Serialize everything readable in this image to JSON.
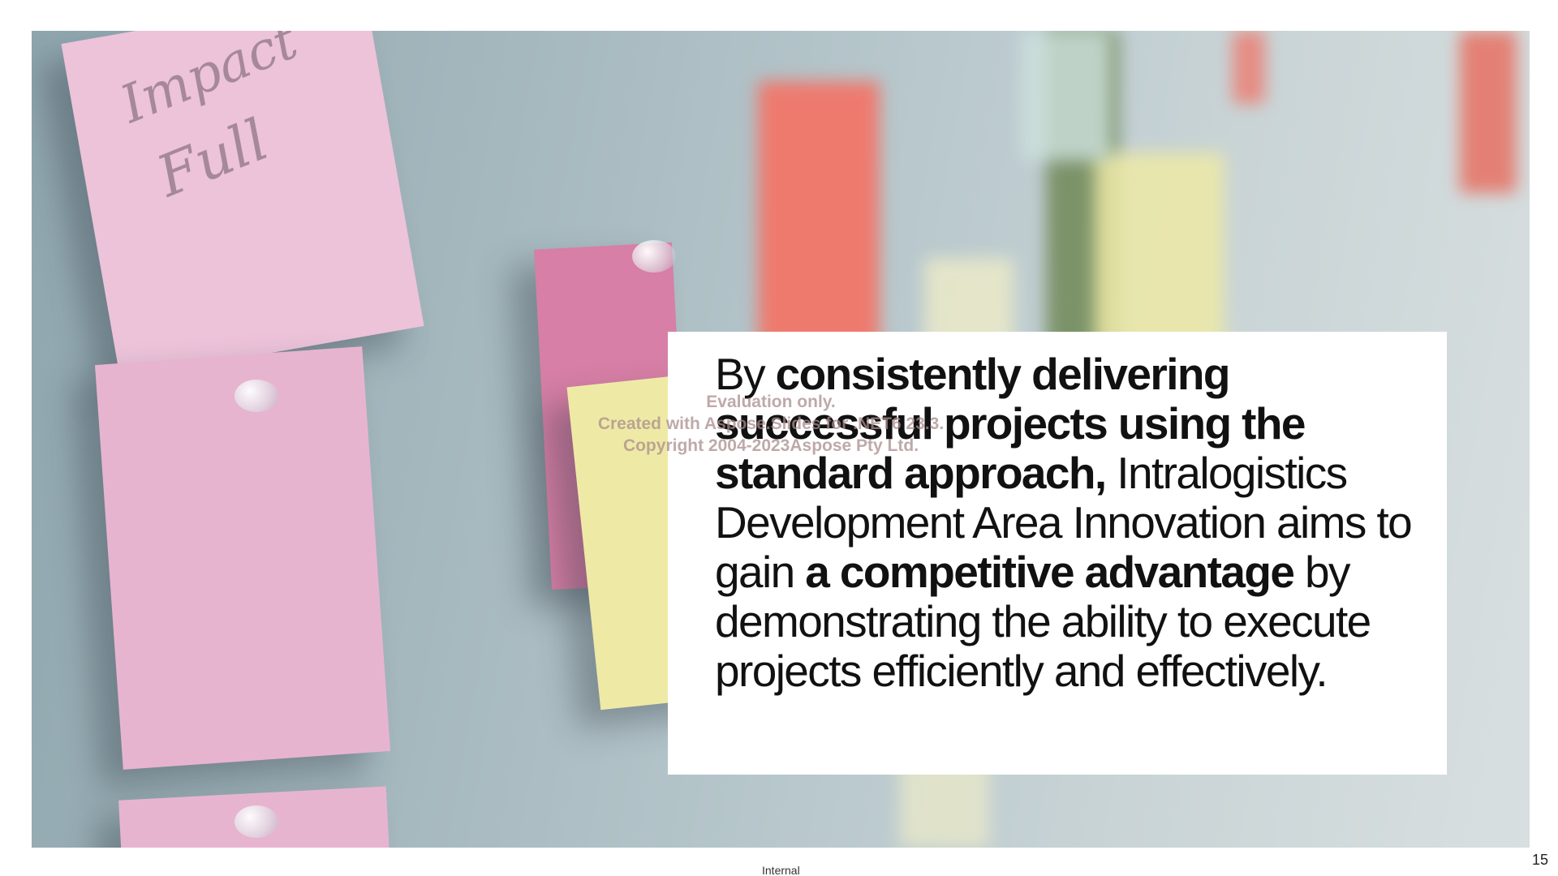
{
  "slide": {
    "background_image": "sticky-notes-pinboard-photo",
    "colors": {
      "board": "#a5b8be",
      "note_pink": "#e9b8d3",
      "note_magenta": "#d77fa6",
      "note_red": "#ee7a6e",
      "note_yellow": "#eeeaa6",
      "text": "#111111"
    },
    "photo_handwriting": {
      "note1_line1": "Impact",
      "note1_line2": "Full"
    },
    "quote": {
      "p1": "By ",
      "b1": "consistently delivering successful projects using the standard approach,",
      "p2": " Intralogistics Development Area Innovation aims to gain ",
      "b2": "a competitive advantage",
      "p3": " by demonstrating the ability to execute projects efficiently and effectively."
    },
    "watermark": {
      "line1": "Evaluation only.",
      "line2": "Created with Aspose.Slides for .NET6 23.3.",
      "line3": "Copyright 2004-2023Aspose Pty Ltd."
    },
    "footer": {
      "classification": "Internal",
      "slide_number": "15"
    }
  }
}
